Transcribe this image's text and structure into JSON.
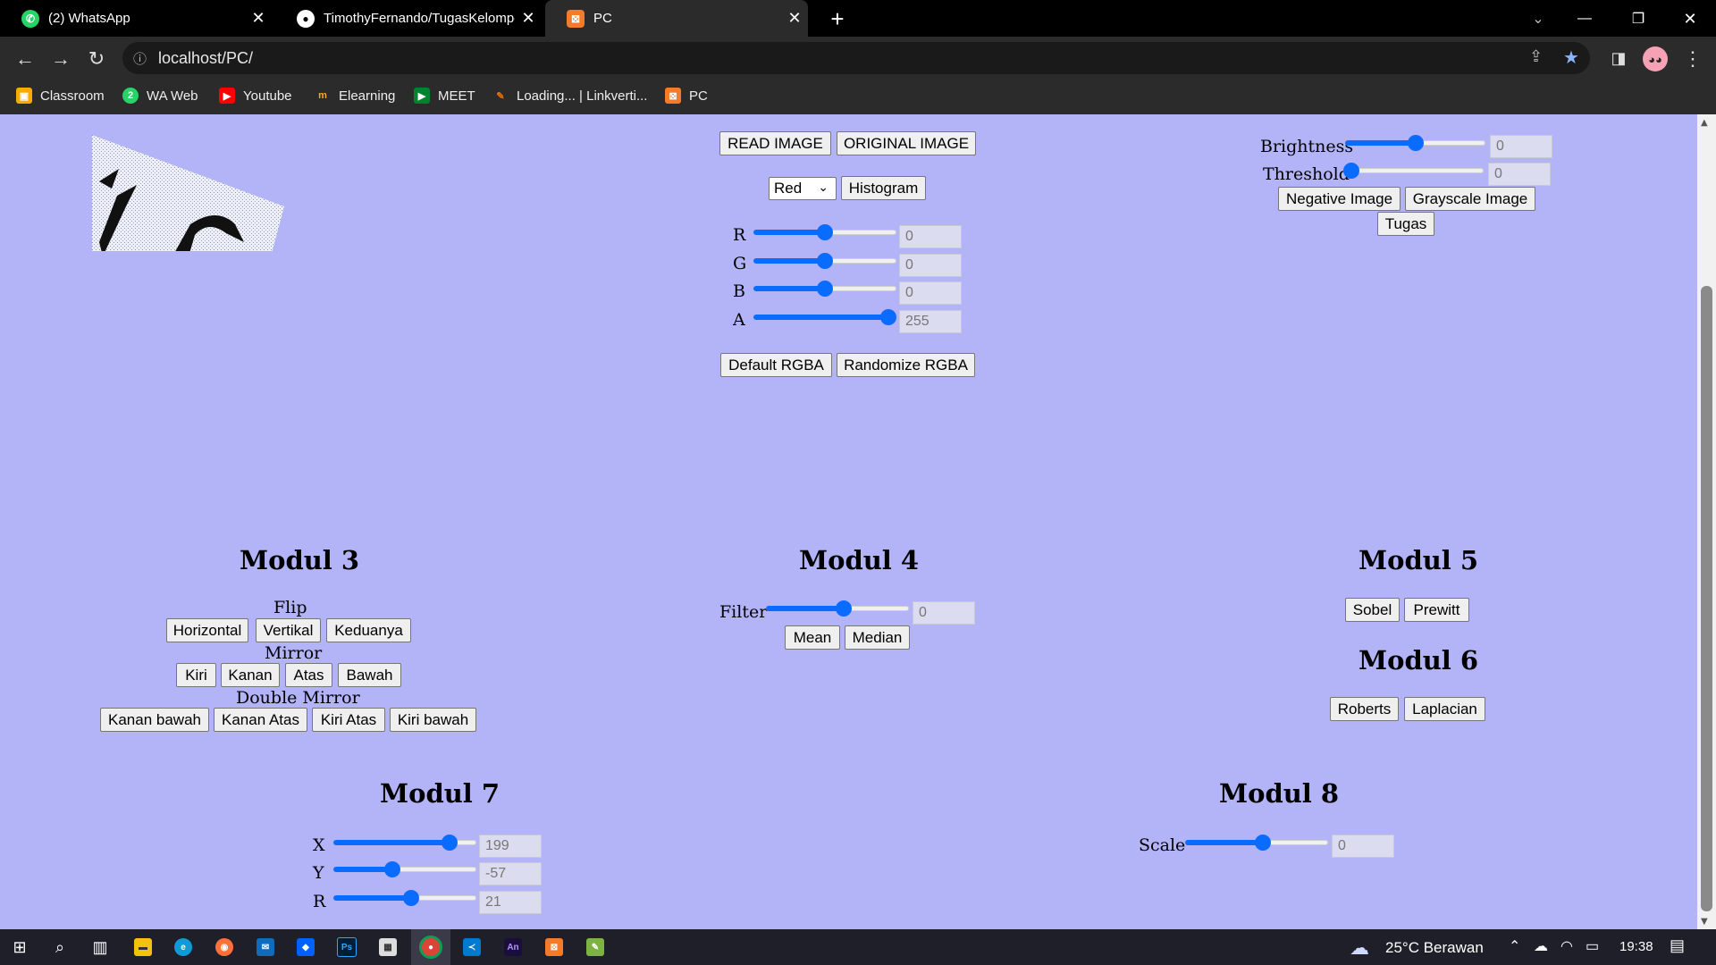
{
  "browser": {
    "tabs": [
      {
        "title": "(2) WhatsApp",
        "active": false
      },
      {
        "title": "TimothyFernando/TugasKelompo",
        "active": false
      },
      {
        "title": "PC",
        "active": true
      }
    ],
    "url": "localhost/PC/",
    "bookmarks": [
      "Classroom",
      "WA Web",
      "Youtube",
      "Elearning",
      "MEET",
      "Loading... | Linkverti...",
      "PC"
    ]
  },
  "controls": {
    "read_image": "READ IMAGE",
    "original_image": "ORIGINAL IMAGE",
    "channel_select": "Red",
    "histogram": "Histogram",
    "rgba": [
      {
        "label": "R",
        "value": "0",
        "level": 0.5
      },
      {
        "label": "G",
        "value": "0",
        "level": 0.5
      },
      {
        "label": "B",
        "value": "0",
        "level": 0.5
      },
      {
        "label": "A",
        "value": "255",
        "level": 1.0
      }
    ],
    "default_rgba": "Default RGBA",
    "randomize_rgba": "Randomize RGBA",
    "brightness": {
      "label": "Brightness",
      "value": "0",
      "level": 0.5
    },
    "threshold": {
      "label": "Threshold",
      "value": "0",
      "level": 0.0
    },
    "negative_image": "Negative Image",
    "grayscale_image": "Grayscale Image",
    "tugas": "Tugas"
  },
  "modul3": {
    "title": "Modul 3",
    "flip_label": "Flip",
    "flip": [
      "Horizontal",
      "Vertikal",
      "Keduanya"
    ],
    "mirror_label": "Mirror",
    "mirror": [
      "Kiri",
      "Kanan",
      "Atas",
      "Bawah"
    ],
    "double_mirror_label": "Double Mirror",
    "double_mirror": [
      "Kanan bawah",
      "Kanan Atas",
      "Kiri Atas",
      "Kiri bawah"
    ]
  },
  "modul4": {
    "title": "Modul 4",
    "filter_label": "Filter",
    "filter_value": "0",
    "filter_level": 0.55,
    "mean": "Mean",
    "median": "Median"
  },
  "modul5": {
    "title": "Modul 5",
    "sobel": "Sobel",
    "prewitt": "Prewitt"
  },
  "modul6": {
    "title": "Modul 6",
    "roberts": "Roberts",
    "laplacian": "Laplacian"
  },
  "modul7": {
    "title": "Modul 7",
    "sliders": [
      {
        "label": "X",
        "value": "199",
        "level": 0.85
      },
      {
        "label": "Y",
        "value": "-57",
        "level": 0.4
      },
      {
        "label": "R",
        "value": "21",
        "level": 0.55
      }
    ]
  },
  "modul8": {
    "title": "Modul 8",
    "scale_label": "Scale",
    "scale_value": "0",
    "scale_level": 0.55
  },
  "taskbar": {
    "weather": "25°C Berawan",
    "time": "19:38"
  }
}
